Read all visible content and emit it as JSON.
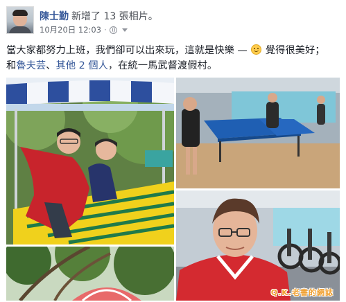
{
  "post": {
    "author": "陳士勤",
    "action_prefix": "新增了",
    "photo_count": "13",
    "action_suffix": "張相片",
    "dot": "。",
    "timestamp": "10月20日 12:03",
    "separator": "·",
    "audience_icon": "globe-icon",
    "text_line1_a": "當大家都努力上班，我們卻可以出來玩，這就是快樂 —",
    "text_line1_b": "覺得很美好；",
    "text_line2_and": "和",
    "tag_person": "魯夫芸",
    "text_line2_sep": "、",
    "others_link": "其他 2 個人",
    "text_line2_end": "，在統一馬武督渡假村。"
  },
  "feeling_icon": "smiling-face-icon",
  "photos": [
    {
      "name": "photo-amusement-ride"
    },
    {
      "name": "photo-table-tennis"
    },
    {
      "name": "photo-trees-umbrella"
    },
    {
      "name": "photo-gym-selfie"
    }
  ],
  "watermark": "Q.K.老書的網誌",
  "colors": {
    "link": "#365899",
    "text": "#1d2129",
    "meta": "#616770"
  }
}
